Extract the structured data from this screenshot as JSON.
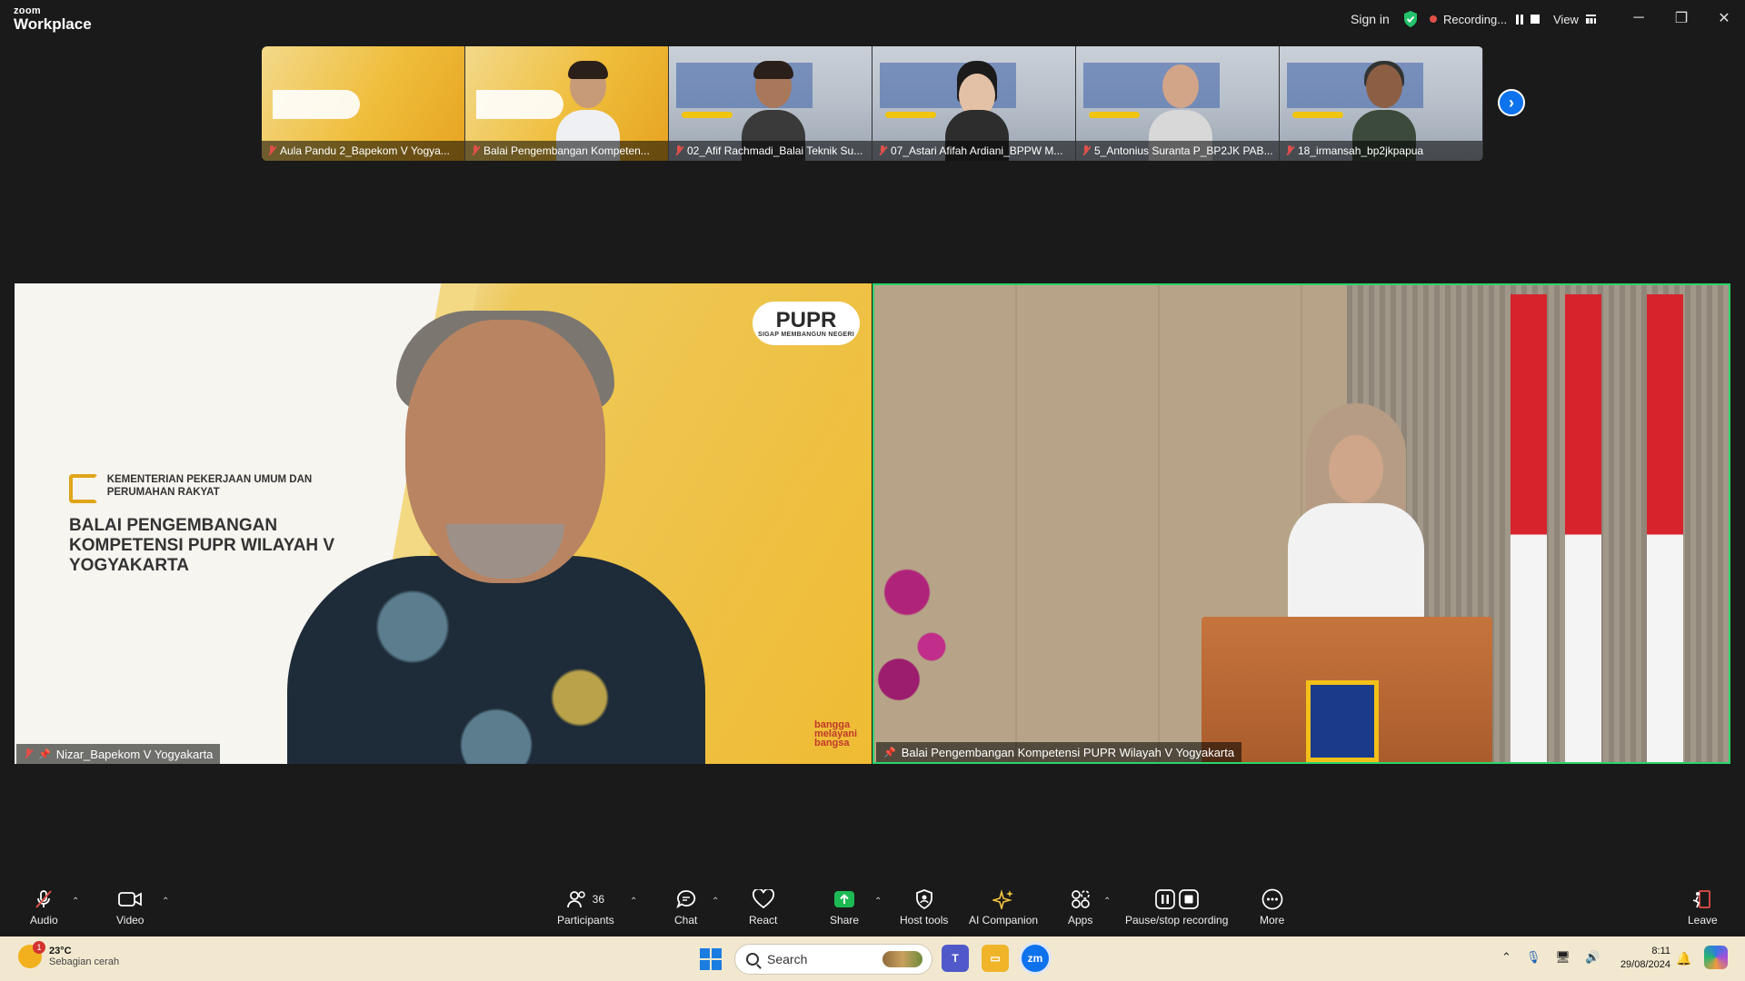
{
  "window": {
    "logo_top": "zoom",
    "logo_bottom": "Workplace",
    "sign_in": "Sign in",
    "recording": "Recording...",
    "view": "View",
    "controls": {
      "minimize": "─",
      "restore": "❐",
      "close": "✕"
    }
  },
  "gallery": {
    "thumbnails": [
      {
        "name": "Aula Pandu 2_Bapekom V Yogya...",
        "muted": true,
        "style": "slide-yellow"
      },
      {
        "name": "Balai Pengembangan Kompeten...",
        "muted": true,
        "style": "slide-yellow-person"
      },
      {
        "name": "02_Afif Rachmadi_Balai Teknik Su...",
        "muted": true,
        "style": "slide-gray-person"
      },
      {
        "name": "07_Astari Afifah Ardiani_BPPW M...",
        "muted": true,
        "style": "slide-gray-person"
      },
      {
        "name": "5_Antonius Suranta P_BP2JK PAB...",
        "muted": true,
        "style": "slide-gray-person"
      },
      {
        "name": "18_irmansah_bp2jkpapua",
        "muted": true,
        "style": "slide-gray-person"
      }
    ],
    "next_label": "›"
  },
  "main": {
    "left_tile": {
      "name": "Nizar_Bapekom V Yogyakarta",
      "muted": true,
      "pinned": true,
      "background": {
        "org_small": "KEMENTERIAN PEKERJAAN UMUM DAN PERUMAHAN RAKYAT",
        "org_big": "BALAI PENGEMBANGAN KOMPETENSI PUPR WILAYAH V YOGYAKARTA",
        "brand": "PUPR",
        "brand_tagline": "SIGAP MEMBANGUN NEGERI",
        "corner_text": "bangga melayani bangsa"
      }
    },
    "right_tile": {
      "name": "Balai Pengembangan Kompetensi PUPR Wilayah V Yogyakarta",
      "pinned": true,
      "active_speaker": true
    }
  },
  "toolbar": {
    "audio": "Audio",
    "video": "Video",
    "participants": "Participants",
    "participants_count": "36",
    "chat": "Chat",
    "react": "React",
    "share": "Share",
    "host_tools": "Host tools",
    "ai_companion": "AI Companion",
    "apps": "Apps",
    "pause_stop": "Pause/stop recording",
    "more": "More",
    "leave": "Leave"
  },
  "taskbar": {
    "weather_temp": "23°C",
    "weather_desc": "Sebagian cerah",
    "weather_badge": "1",
    "search_placeholder": "Search",
    "time": "8:11",
    "date": "29/08/2024"
  },
  "colors": {
    "accent": "#0e72ed",
    "active_speaker_border": "#2bd46a",
    "share_green": "#1db954",
    "muted_red": "#e0504a"
  }
}
